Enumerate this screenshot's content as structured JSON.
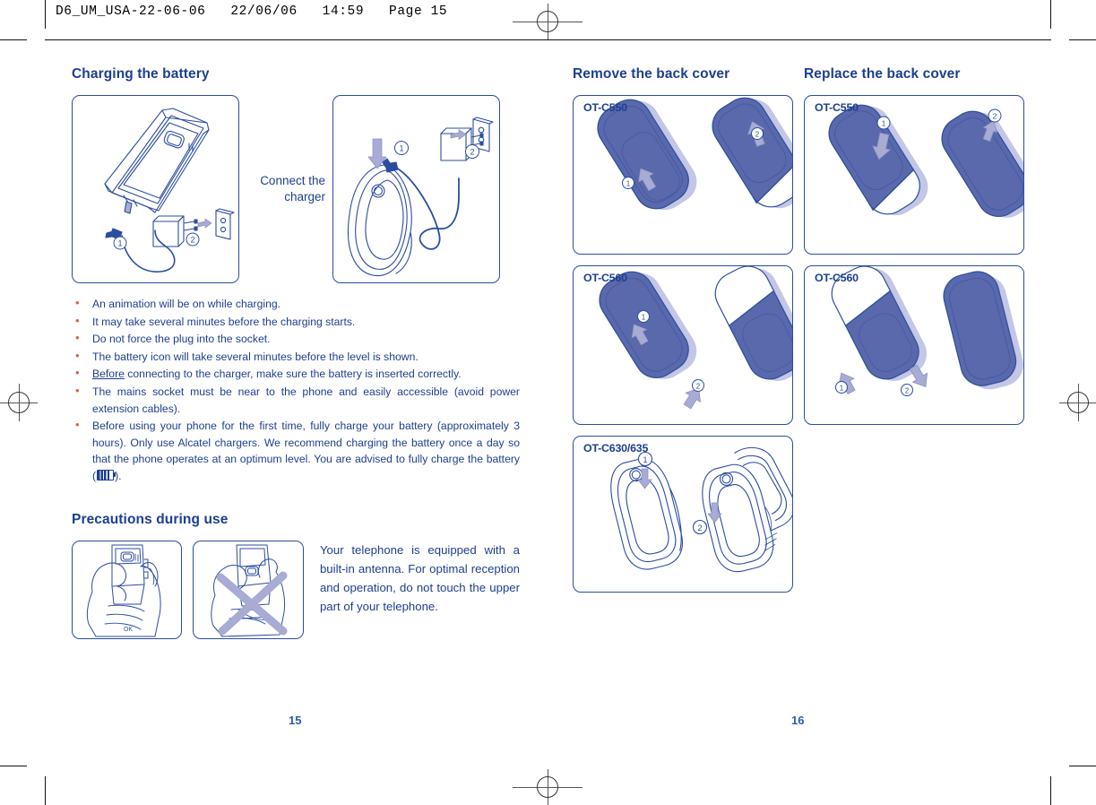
{
  "print_header": "D6_UM_USA-22-06-06   22/06/06   14:59   Page 15",
  "left_page": {
    "section_charging": {
      "heading": "Charging the battery",
      "connect_caption": "Connect the charger",
      "figure_1_name": "phone-charger-connection-diagram",
      "figure_2_name": "phone-charger-wall-socket-diagram",
      "bullets": [
        {
          "text": "An animation will be on while charging."
        },
        {
          "text": "It may take several minutes before the charging starts."
        },
        {
          "text": "Do not force the plug into the socket."
        },
        {
          "text": "The battery icon will take several minutes before the level is shown."
        },
        {
          "underlined_lead": "Before",
          "text": " connecting to the charger, make sure the battery is inserted correctly."
        },
        {
          "text": "The mains socket must be near to the phone and easily accessible (avoid power extension cables)."
        },
        {
          "text_before_icon": "Before using your phone for the first time, fully charge your battery (approximately 3 hours). Only use Alcatel chargers. We recommend charging the battery once a day so that the phone operates at an optimum level. You are advised to fully charge the battery (",
          "icon": "battery-full-icon",
          "text_after_icon": ")."
        }
      ]
    },
    "section_precautions": {
      "heading": "Precautions during use",
      "figure_ok_name": "hand-holding-phone-correct-ok",
      "figure_ok_label": "OK",
      "figure_bad_name": "hand-holding-phone-incorrect-crossed",
      "body": "Your telephone is equipped with a built-in antenna. For optimal reception and operation, do not touch the upper part of your telephone."
    },
    "page_number": "15"
  },
  "right_page": {
    "column_remove": {
      "heading": "Remove the back cover",
      "boxes": [
        {
          "label": "OT-C550",
          "steps": [
            "1",
            "2"
          ],
          "figure": "ot-c550-remove-cover-diagram"
        },
        {
          "label": "OT-C560",
          "steps": [
            "1",
            "2"
          ],
          "figure": "ot-c560-remove-cover-diagram"
        },
        {
          "label": "OT-C630/635",
          "steps": [
            "1",
            "2"
          ],
          "figure": "ot-c630-635-remove-cover-diagram"
        }
      ]
    },
    "column_replace": {
      "heading": "Replace the back cover",
      "boxes": [
        {
          "label": "OT-C550",
          "steps": [
            "1",
            "2"
          ],
          "figure": "ot-c550-replace-cover-diagram"
        },
        {
          "label": "OT-C560",
          "steps": [
            "1",
            "2"
          ],
          "figure": "ot-c560-replace-cover-diagram"
        }
      ]
    },
    "page_number": "16"
  },
  "colors": {
    "heading_blue": "#1d3f8f",
    "body_blue": "#1d3f8f",
    "bullet_orange": "#d9633b",
    "illustration_line": "#2b4da0",
    "phone_fill": "#5a68ac",
    "phone_shadow": "#c3c6e4",
    "arrow_fill": "#a8abd4"
  }
}
